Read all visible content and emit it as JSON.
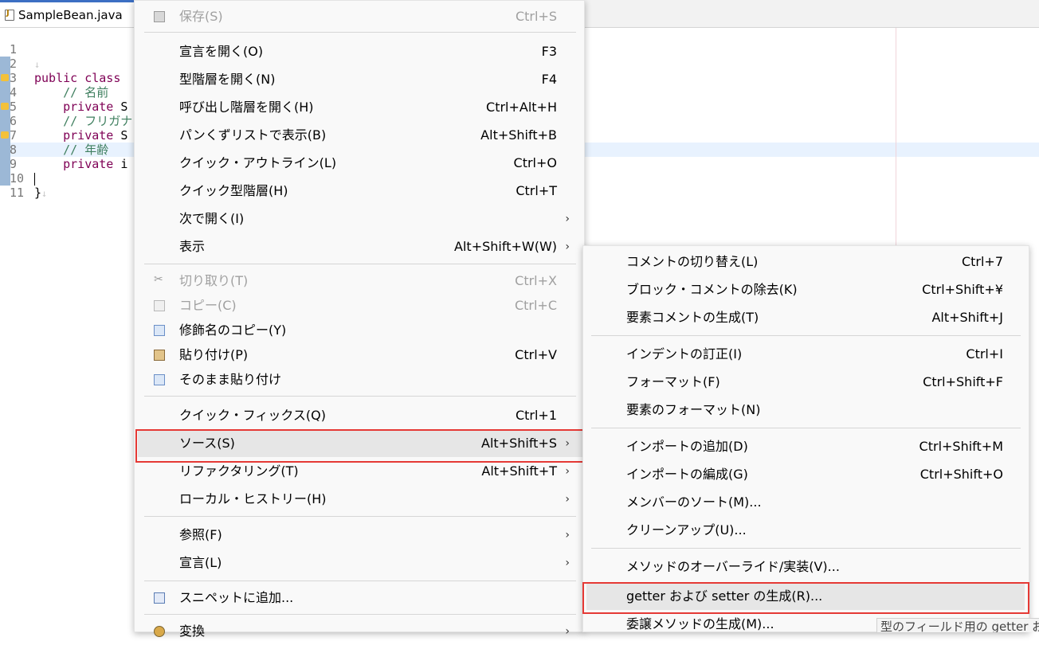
{
  "editor": {
    "tab_title": "SampleBean.java",
    "lines": [
      {
        "n": "1",
        "text": ""
      },
      {
        "n": "2",
        "kw": "public class",
        "rest": ""
      },
      {
        "n": "3",
        "cm": "// 名前"
      },
      {
        "n": "4",
        "kw": "private",
        "rest": " S"
      },
      {
        "n": "5",
        "cm": "// フリガナ"
      },
      {
        "n": "6",
        "kw": "private",
        "rest": " S"
      },
      {
        "n": "7",
        "cm": "// 年齢"
      },
      {
        "n": "8",
        "kw": "private",
        "rest": " i"
      },
      {
        "n": "9",
        "text": ""
      },
      {
        "n": "10",
        "text": "}"
      },
      {
        "n": "11",
        "text": ""
      }
    ]
  },
  "context_menu": {
    "items": [
      {
        "label": "保存(S)",
        "shortcut": "Ctrl+S"
      },
      {
        "label": "宣言を開く(O)",
        "shortcut": "F3"
      },
      {
        "label": "型階層を開く(N)",
        "shortcut": "F4"
      },
      {
        "label": "呼び出し階層を開く(H)",
        "shortcut": "Ctrl+Alt+H"
      },
      {
        "label": "パンくずリストで表示(B)",
        "shortcut": "Alt+Shift+B"
      },
      {
        "label": "クイック・アウトライン(L)",
        "shortcut": "Ctrl+O"
      },
      {
        "label": "クイック型階層(H)",
        "shortcut": "Ctrl+T"
      },
      {
        "label": "次で開く(I)",
        "shortcut": ""
      },
      {
        "label": "表示",
        "shortcut": "Alt+Shift+W(W)"
      },
      {
        "label": "切り取り(T)",
        "shortcut": "Ctrl+X"
      },
      {
        "label": "コピー(C)",
        "shortcut": "Ctrl+C"
      },
      {
        "label": "修飾名のコピー(Y)",
        "shortcut": ""
      },
      {
        "label": "貼り付け(P)",
        "shortcut": "Ctrl+V"
      },
      {
        "label": "そのまま貼り付け",
        "shortcut": ""
      },
      {
        "label": "クイック・フィックス(Q)",
        "shortcut": "Ctrl+1"
      },
      {
        "label": "ソース(S)",
        "shortcut": "Alt+Shift+S"
      },
      {
        "label": "リファクタリング(T)",
        "shortcut": "Alt+Shift+T"
      },
      {
        "label": "ローカル・ヒストリー(H)",
        "shortcut": ""
      },
      {
        "label": "参照(F)",
        "shortcut": ""
      },
      {
        "label": "宣言(L)",
        "shortcut": ""
      },
      {
        "label": "スニペットに追加...",
        "shortcut": ""
      },
      {
        "label": "変換",
        "shortcut": ""
      }
    ]
  },
  "source_submenu": {
    "items": [
      {
        "label": "コメントの切り替え(L)",
        "shortcut": "Ctrl+7"
      },
      {
        "label": "ブロック・コメントの除去(K)",
        "shortcut": "Ctrl+Shift+¥"
      },
      {
        "label": "要素コメントの生成(T)",
        "shortcut": "Alt+Shift+J"
      },
      {
        "label": "インデントの訂正(I)",
        "shortcut": "Ctrl+I"
      },
      {
        "label": "フォーマット(F)",
        "shortcut": "Ctrl+Shift+F"
      },
      {
        "label": "要素のフォーマット(N)",
        "shortcut": ""
      },
      {
        "label": "インポートの追加(D)",
        "shortcut": "Ctrl+Shift+M"
      },
      {
        "label": "インポートの編成(G)",
        "shortcut": "Ctrl+Shift+O"
      },
      {
        "label": "メンバーのソート(M)...",
        "shortcut": ""
      },
      {
        "label": "クリーンアップ(U)...",
        "shortcut": ""
      },
      {
        "label": "メソッドのオーバーライド/実装(V)...",
        "shortcut": ""
      },
      {
        "label": "getter および setter の生成(R)...",
        "shortcut": ""
      },
      {
        "label": "委譲メソッドの生成(M)...",
        "shortcut": ""
      }
    ]
  },
  "tooltip": {
    "text": "型のフィールド用の getter お"
  },
  "colors": {
    "highlight_border": "#e53935",
    "keyword": "#7f0055",
    "comment": "#3f7f5f"
  }
}
